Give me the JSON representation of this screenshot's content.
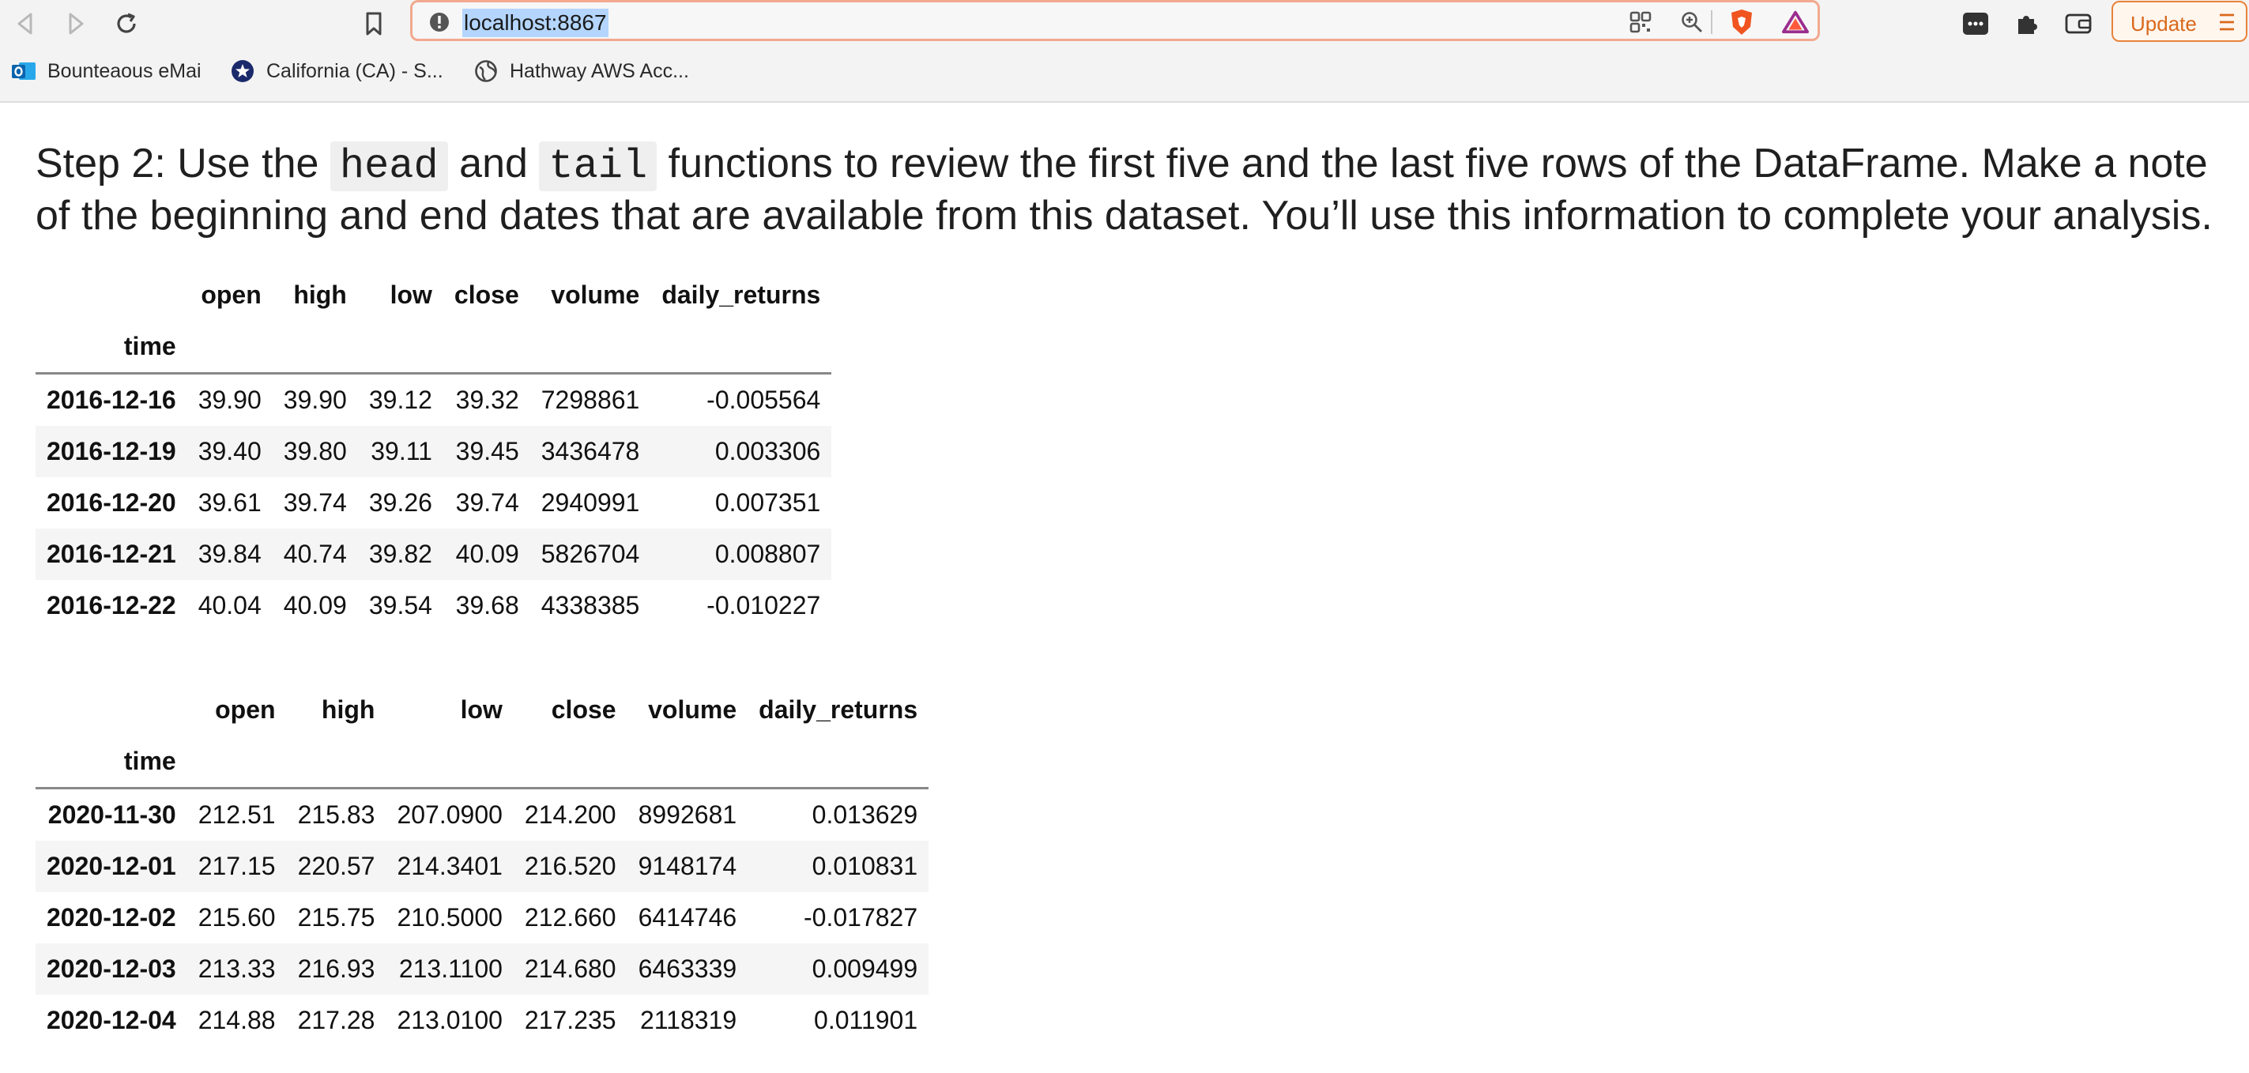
{
  "browser": {
    "url": "localhost:8867",
    "update_label": "Update",
    "bookmarks": [
      {
        "label": "Bounteaous eMai",
        "icon": "outlook-icon"
      },
      {
        "label": "California (CA) - S...",
        "icon": "star-seal-icon"
      },
      {
        "label": "Hathway AWS Acc...",
        "icon": "globe-icon"
      }
    ]
  },
  "notebook": {
    "heading": {
      "part1": "Step 2: Use the ",
      "code1": "head",
      "part2": " and ",
      "code2": "tail",
      "part3": " functions to review the first five and the last five rows of the DataFrame. Make a note of the beginning and end dates that are available from this dataset. You’ll use this information to complete your analysis."
    },
    "head_table": {
      "columns": [
        "open",
        "high",
        "low",
        "close",
        "volume",
        "daily_returns"
      ],
      "index_name": "time",
      "rows": [
        {
          "index": "2016-12-16",
          "values": [
            "39.90",
            "39.90",
            "39.12",
            "39.32",
            "7298861",
            "-0.005564"
          ]
        },
        {
          "index": "2016-12-19",
          "values": [
            "39.40",
            "39.80",
            "39.11",
            "39.45",
            "3436478",
            "0.003306"
          ]
        },
        {
          "index": "2016-12-20",
          "values": [
            "39.61",
            "39.74",
            "39.26",
            "39.74",
            "2940991",
            "0.007351"
          ]
        },
        {
          "index": "2016-12-21",
          "values": [
            "39.84",
            "40.74",
            "39.82",
            "40.09",
            "5826704",
            "0.008807"
          ]
        },
        {
          "index": "2016-12-22",
          "values": [
            "40.04",
            "40.09",
            "39.54",
            "39.68",
            "4338385",
            "-0.010227"
          ]
        }
      ]
    },
    "tail_table": {
      "columns": [
        "open",
        "high",
        "low",
        "close",
        "volume",
        "daily_returns"
      ],
      "index_name": "time",
      "rows": [
        {
          "index": "2020-11-30",
          "values": [
            "212.51",
            "215.83",
            "207.0900",
            "214.200",
            "8992681",
            "0.013629"
          ]
        },
        {
          "index": "2020-12-01",
          "values": [
            "217.15",
            "220.57",
            "214.3401",
            "216.520",
            "9148174",
            "0.010831"
          ]
        },
        {
          "index": "2020-12-02",
          "values": [
            "215.60",
            "215.75",
            "210.5000",
            "212.660",
            "6414746",
            "-0.017827"
          ]
        },
        {
          "index": "2020-12-03",
          "values": [
            "213.33",
            "216.93",
            "213.1100",
            "214.680",
            "6463339",
            "0.009499"
          ]
        },
        {
          "index": "2020-12-04",
          "values": [
            "214.88",
            "217.28",
            "213.0100",
            "217.235",
            "2118319",
            "0.011901"
          ]
        }
      ]
    }
  }
}
